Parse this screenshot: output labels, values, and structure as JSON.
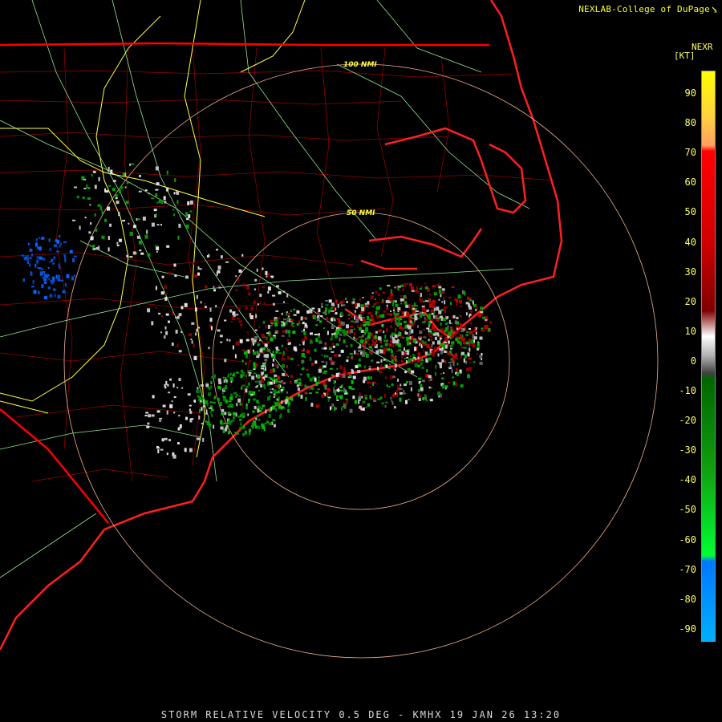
{
  "header": {
    "credit": "NEXLAB-College of DuPage",
    "credit_icon": "cursor-icon"
  },
  "legend": {
    "title": "NEXR",
    "unit": "[KT]",
    "ticks": [
      "90",
      "80",
      "70",
      "60",
      "50",
      "40",
      "30",
      "20",
      "10",
      "0",
      "-10",
      "-20",
      "-30",
      "-40",
      "-50",
      "-60",
      "-70",
      "-80",
      "-90"
    ],
    "colors": {
      "outbound_high": "#ffff00",
      "outbound_mid": "#ff0000",
      "outbound_low": "#800000",
      "near_zero": "#b0b0b0",
      "inbound_low": "#006600",
      "inbound_mid": "#00ff33",
      "inbound_high": "#0077ff"
    }
  },
  "map": {
    "range_rings": [
      "50 NMI",
      "100 NMI"
    ],
    "colors": {
      "state_lines": "#ff0000",
      "county_lines": "#a00000",
      "coastline": "#ff2020",
      "interstates": "#ffff44",
      "highways": "#90e890",
      "range_rings": "#f0b090"
    }
  },
  "footer": {
    "caption": "STORM RELATIVE VELOCITY 0.5 DEG - KMHX 19 JAN 26 13:20"
  }
}
